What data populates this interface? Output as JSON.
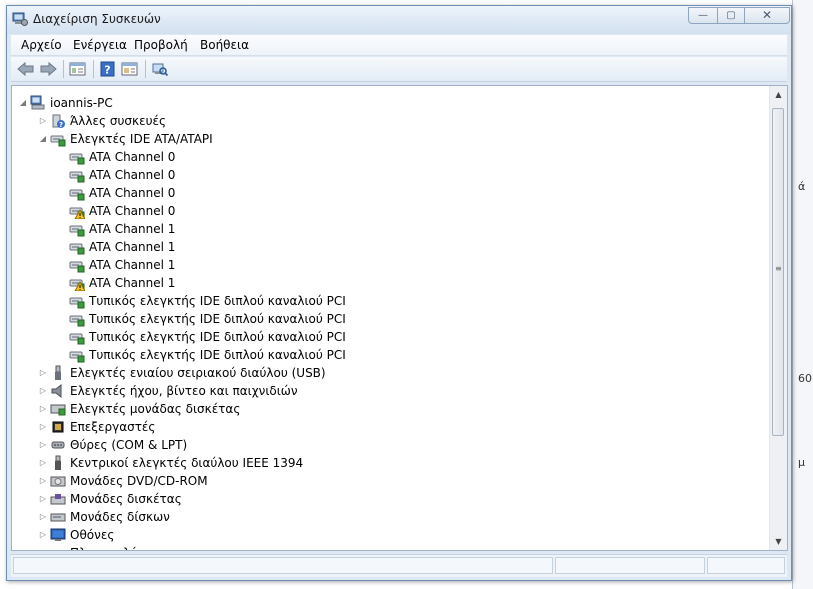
{
  "window": {
    "title": "Διαχείριση Συσκευών",
    "controls": {
      "minimize": "—",
      "maximize": "▢",
      "close": "✕"
    }
  },
  "menu": [
    "Αρχείο",
    "Ενέργεια",
    "Προβολή",
    "Βοήθεια"
  ],
  "toolbar": {
    "icons": [
      "back-icon",
      "forward-icon",
      "show-hide-tree-icon",
      "help-icon",
      "properties-icon",
      "scan-hardware-icon"
    ],
    "help_glyph": "?"
  },
  "tree": {
    "root": {
      "label": "ioannis-PC",
      "icon": "computer-icon",
      "expanded": true
    },
    "nodes": [
      {
        "label": "Άλλες συσκευές",
        "icon": "unknown-device-icon",
        "level": 1,
        "expander": "▷"
      },
      {
        "label": "Ελεγκτές IDE ATA/ATAPI",
        "icon": "ide-controller-icon",
        "level": 1,
        "expander": "◢"
      },
      {
        "label": "ATA Channel 0",
        "icon": "ide-channel-icon",
        "level": 2,
        "warning": false
      },
      {
        "label": "ATA Channel 0",
        "icon": "ide-channel-icon",
        "level": 2,
        "warning": false
      },
      {
        "label": "ATA Channel 0",
        "icon": "ide-channel-icon",
        "level": 2,
        "warning": false
      },
      {
        "label": "ATA Channel 0",
        "icon": "ide-channel-warning-icon",
        "level": 2,
        "warning": true
      },
      {
        "label": "ATA Channel 1",
        "icon": "ide-channel-icon",
        "level": 2,
        "warning": false
      },
      {
        "label": "ATA Channel 1",
        "icon": "ide-channel-icon",
        "level": 2,
        "warning": false
      },
      {
        "label": "ATA Channel 1",
        "icon": "ide-channel-icon",
        "level": 2,
        "warning": false
      },
      {
        "label": "ATA Channel 1",
        "icon": "ide-channel-warning-icon",
        "level": 2,
        "warning": true
      },
      {
        "label": "Τυπικός ελεγκτής IDE διπλού καναλιού PCI",
        "icon": "ide-channel-icon",
        "level": 2,
        "warning": false
      },
      {
        "label": "Τυπικός ελεγκτής IDE διπλού καναλιού PCI",
        "icon": "ide-channel-icon",
        "level": 2,
        "warning": false
      },
      {
        "label": "Τυπικός ελεγκτής IDE διπλού καναλιού PCI",
        "icon": "ide-channel-icon",
        "level": 2,
        "warning": false
      },
      {
        "label": "Τυπικός ελεγκτής IDE διπλού καναλιού PCI",
        "icon": "ide-channel-icon",
        "level": 2,
        "warning": false
      },
      {
        "label": "Ελεγκτές ενιαίου σειριακού διαύλου (USB)",
        "icon": "usb-icon",
        "level": 1,
        "expander": "▷"
      },
      {
        "label": "Ελεγκτές ήχου, βίντεο και παιχνιδιών",
        "icon": "speaker-icon",
        "level": 1,
        "expander": "▷"
      },
      {
        "label": "Ελεγκτές μονάδας δισκέτας",
        "icon": "floppy-controller-icon",
        "level": 1,
        "expander": "▷"
      },
      {
        "label": "Επεξεργαστές",
        "icon": "processor-icon",
        "level": 1,
        "expander": "▷"
      },
      {
        "label": "Θύρες (COM & LPT)",
        "icon": "port-icon",
        "level": 1,
        "expander": "▷"
      },
      {
        "label": "Κεντρικοί ελεγκτές διαύλου IEEE 1394",
        "icon": "firewire-icon",
        "level": 1,
        "expander": "▷"
      },
      {
        "label": "Μονάδες DVD/CD-ROM",
        "icon": "dvd-drive-icon",
        "level": 1,
        "expander": "▷"
      },
      {
        "label": "Μονάδες δισκέτας",
        "icon": "floppy-drive-icon",
        "level": 1,
        "expander": "▷"
      },
      {
        "label": "Μονάδες δίσκων",
        "icon": "disk-drive-icon",
        "level": 1,
        "expander": "▷"
      },
      {
        "label": "Οθόνες",
        "icon": "monitor-icon",
        "level": 1,
        "expander": "▷"
      },
      {
        "label": "Πληκτρολόγια",
        "icon": "keyboard-icon",
        "level": 1,
        "expander": "▷"
      }
    ]
  },
  "scrollbar": {
    "up": "▲",
    "down": "▼",
    "grip": "≡"
  },
  "background_window_fragments": [
    "ά",
    "60",
    "μ"
  ],
  "colors": {
    "warning": "#f3c316",
    "device_green": "#3d9a3d",
    "selection": "#cce4f7"
  }
}
